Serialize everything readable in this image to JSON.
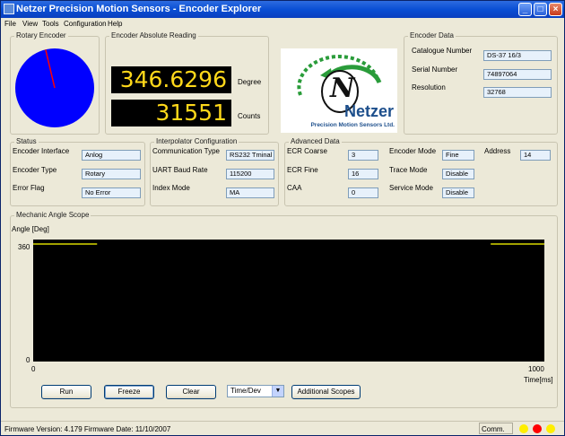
{
  "window": {
    "title": "Netzer Precision Motion Sensors - Encoder Explorer"
  },
  "menu": [
    "File",
    "View",
    "Tools",
    "Configuration",
    "Help"
  ],
  "rotary": {
    "caption": "Rotary Encoder",
    "disc_color": "#0000ff",
    "needle_color": "#ff0000",
    "angle_deg": 346.6296
  },
  "reading": {
    "caption": "Encoder Absolute Reading",
    "degree_value": "346.6296",
    "degree_unit": "Degree",
    "counts_value": "31551",
    "counts_unit": "Counts"
  },
  "logo": {
    "letter": "N",
    "brand": "Netzer",
    "tagline": "Precision Motion Sensors Ltd."
  },
  "encoder_data": {
    "caption": "Encoder Data",
    "rows": [
      {
        "label": "Catalogue Number",
        "value": "DS-37 16/3"
      },
      {
        "label": "Serial Number",
        "value": "74897064"
      },
      {
        "label": "Resolution",
        "value": "32768"
      }
    ]
  },
  "status": {
    "caption": "Status",
    "rows": [
      {
        "label": "Encoder Interface",
        "value": "Anlog"
      },
      {
        "label": "Encoder Type",
        "value": "Rotary"
      },
      {
        "label": "Error Flag",
        "value": "No Error"
      }
    ]
  },
  "interpolator": {
    "caption": "Interpolator Configuration",
    "rows": [
      {
        "label": "Communication Type",
        "value": "RS232 Tminal"
      },
      {
        "label": "UART Baud Rate",
        "value": "115200"
      },
      {
        "label": "Index Mode",
        "value": "MA"
      }
    ]
  },
  "advanced": {
    "caption": "Advanced Data",
    "left": [
      {
        "label": "ECR Coarse",
        "value": "3"
      },
      {
        "label": "ECR Fine",
        "value": "16"
      },
      {
        "label": "CAA",
        "value": "0"
      }
    ],
    "middle": [
      {
        "label": "Encoder Mode",
        "value": "Fine"
      },
      {
        "label": "Trace Mode",
        "value": "Disable"
      },
      {
        "label": "Service Mode",
        "value": "Disable"
      }
    ],
    "address": {
      "label": "Address",
      "value": "14"
    }
  },
  "scope": {
    "caption": "Mechanic Angle Scope",
    "ylabel": "Angle [Deg]",
    "y_top": "360",
    "y_bottom": "0",
    "x_left": "0",
    "x_right": "1000",
    "xlabel": "Time[ms]",
    "trace_color": "#d8d800"
  },
  "buttons": {
    "run": "Run",
    "freeze": "Freeze",
    "clear": "Clear",
    "time_dev": "Time/Dev",
    "additional": "Additional Scopes"
  },
  "statusbar": {
    "firmware": "Firmware Version: 4.179   Firmware Date: 11/10/2007",
    "comm": "Comm.",
    "dot_colors": [
      "#ffee00",
      "#ff0000",
      "#ffee00"
    ]
  },
  "chart_data": {
    "type": "line",
    "title": "Mechanic Angle Scope",
    "xlabel": "Time[ms]",
    "ylabel": "Angle [Deg]",
    "xlim": [
      0,
      1000
    ],
    "ylim": [
      0,
      360
    ],
    "series": [
      {
        "x": [
          0,
          125
        ],
        "y": [
          346.6,
          346.6
        ]
      },
      {
        "x": [
          895,
          1000
        ],
        "y": [
          346.6,
          346.6
        ]
      }
    ]
  }
}
